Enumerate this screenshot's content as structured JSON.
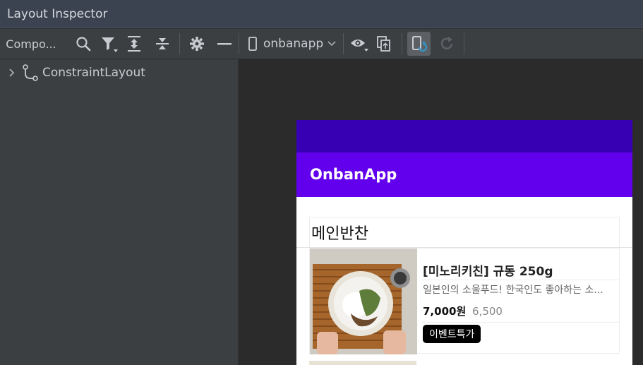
{
  "window": {
    "title": "Layout Inspector"
  },
  "toolbar": {
    "component_tree_label": "Compo...",
    "device_label": "onbanapp",
    "icons": [
      "search-icon",
      "filter-icon",
      "expand-all-icon",
      "collapse-all-icon",
      "gear-icon",
      "minimize-icon",
      "device-icon",
      "chevron-down-icon",
      "eye-icon",
      "export-icon",
      "live-updates-icon",
      "refresh-icon"
    ]
  },
  "tree": {
    "root_label": "ConstraintLayout"
  },
  "app": {
    "title": "OnbanApp",
    "statusbar_color": "#3700b3",
    "appbar_color": "#6200ee",
    "section_title": "메인반찬",
    "items": [
      {
        "name": "[미노리키친] 규동 250g",
        "description": "일본인의 소울푸드! 한국인도 좋아하는 소...",
        "price": "7,000원",
        "original_price": "6,500",
        "badge": "이벤트특가"
      }
    ]
  }
}
